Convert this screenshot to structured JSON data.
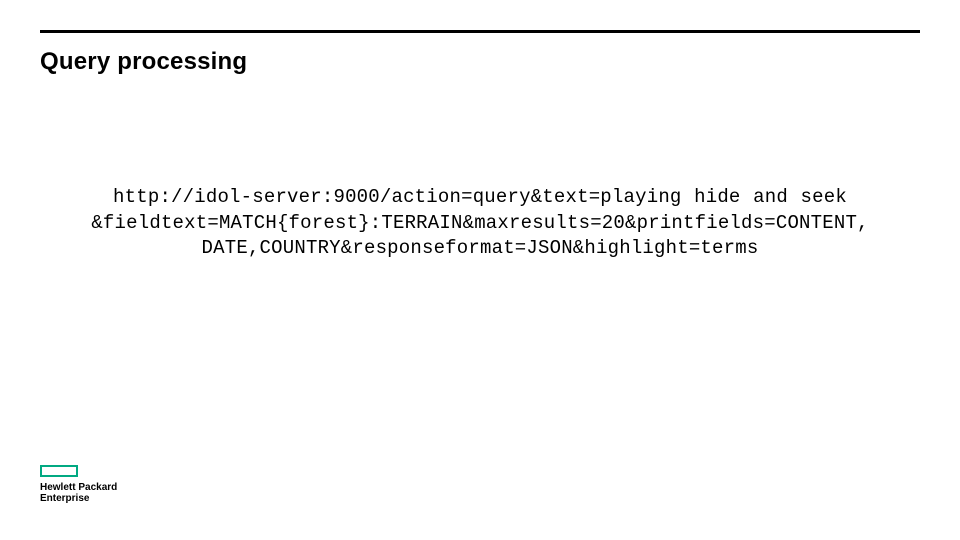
{
  "slide": {
    "title": "Query processing",
    "code_lines": {
      "l1": "http://idol-server:9000/action=query&text=playing hide and seek",
      "l2": "&fieldtext=MATCH{forest}:TERRAIN&maxresults=20&printfields=CONTENT,",
      "l3": "DATE,COUNTRY&responseformat=JSON&highlight=terms"
    }
  },
  "branding": {
    "line1": "Hewlett Packard",
    "line2": "Enterprise",
    "accent_color": "#01a982"
  }
}
